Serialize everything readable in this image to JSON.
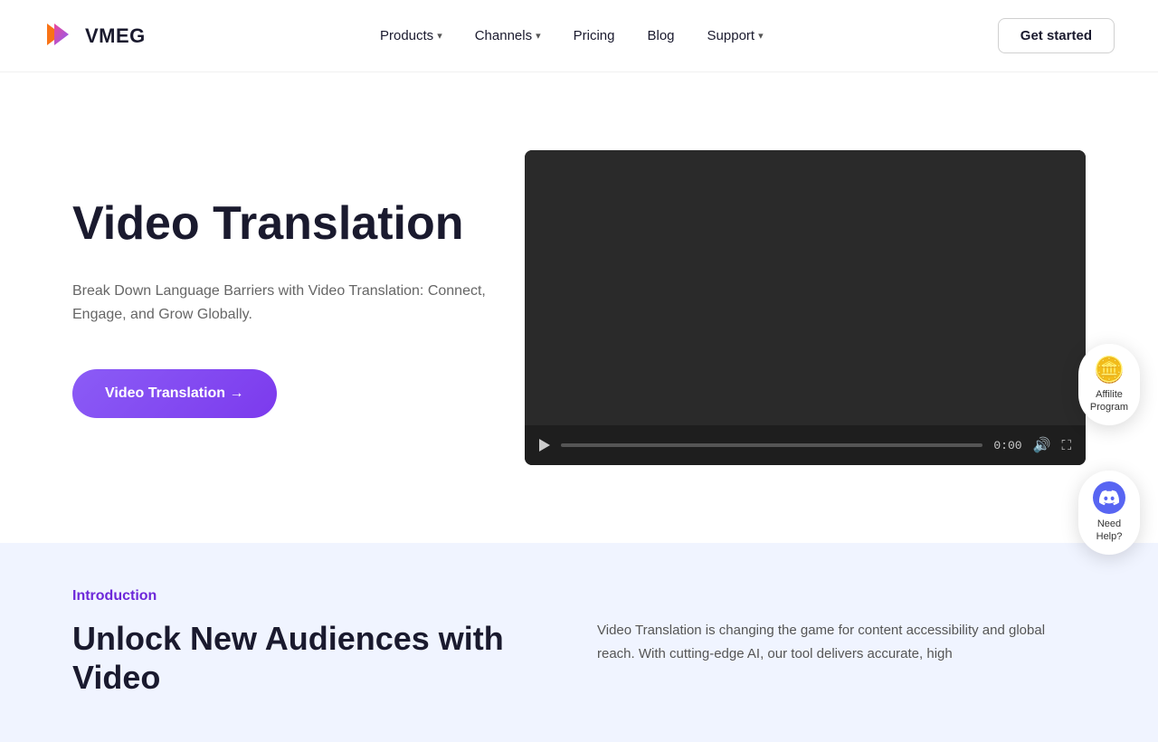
{
  "logo": {
    "text": "VMEG"
  },
  "navbar": {
    "links": [
      {
        "label": "Products",
        "hasDropdown": true
      },
      {
        "label": "Channels",
        "hasDropdown": true
      },
      {
        "label": "Pricing",
        "hasDropdown": false
      },
      {
        "label": "Blog",
        "hasDropdown": false
      },
      {
        "label": "Support",
        "hasDropdown": true
      }
    ],
    "cta_label": "Get started"
  },
  "hero": {
    "title": "Video Translation",
    "description": "Break Down Language Barriers with Video Translation: Connect, Engage, and Grow Globally.",
    "cta_button": "Video Translation →"
  },
  "video": {
    "time": "0:00"
  },
  "affiliate": {
    "label": "Affilite Program"
  },
  "discord": {
    "label": "Need Help?"
  },
  "bottom": {
    "intro_label": "Introduction",
    "title": "Unlock New Audiences with Video",
    "description": "Video Translation is changing the game for content accessibility and global reach. With cutting-edge AI, our tool delivers accurate, high"
  }
}
